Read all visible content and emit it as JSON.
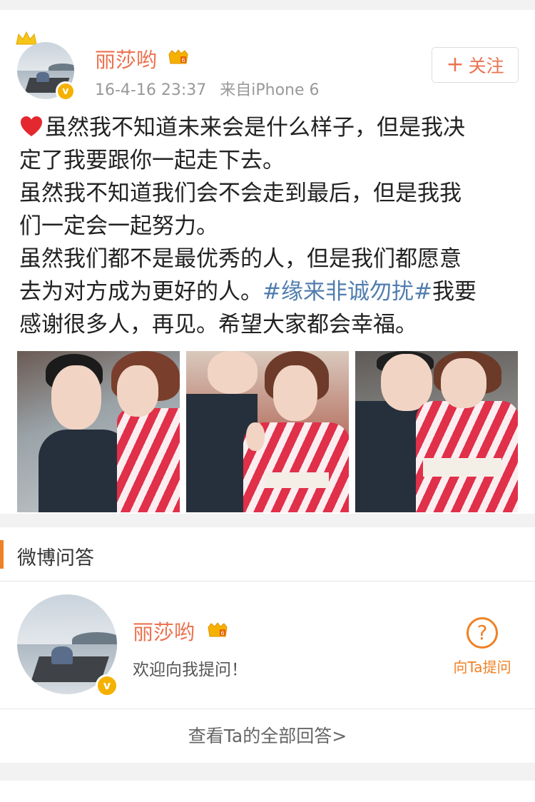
{
  "post": {
    "author": "丽莎哟",
    "date": "16-4-16 23:37",
    "source": "来自iPhone 6",
    "follow_label": "关注",
    "follow_plus": "+",
    "verified_mark": "v",
    "text_lines": [
      "虽然我不知道未来会是什么样子，但是我决",
      "定了我要跟你一起走下去。",
      "虽然我不知道我们会不会走到最后，但是我我",
      "们一定会一起努力。",
      "虽然我们都不是最优秀的人，但是我们都愿意",
      "去为对方成为更好的人。"
    ],
    "topic": "#缘来非诚勿扰#",
    "after_topic": "我要",
    "last_line": "感谢很多人，再见。希望大家都会幸福。",
    "photo_count": 3
  },
  "qa": {
    "section_title": "微博问答",
    "author": "丽莎哟",
    "verified_mark": "v",
    "description": "欢迎向我提问！",
    "ask_icon": "?",
    "ask_label": "向Ta提问",
    "view_all": "查看Ta的全部回答>"
  },
  "colors": {
    "name": "#eb7350",
    "topic": "#507daf",
    "accent": "#f08125",
    "verified": "#f5b100"
  },
  "icons": [
    "crown-icon",
    "vip-icon",
    "heart-icon",
    "verified-icon",
    "question-icon"
  ]
}
